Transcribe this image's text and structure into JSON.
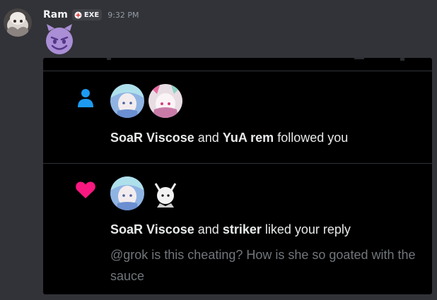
{
  "message": {
    "username": "Ram",
    "tag": "EXE",
    "timestamp": "9:32 PM",
    "emoji": "smiling-imp-emoji"
  },
  "notifications": [
    {
      "icon": "person-icon",
      "user1": "SoaR Viscose",
      "connector": "and",
      "user2": "YuA rem",
      "action": "followed you"
    },
    {
      "icon": "heart-icon",
      "user1": "SoaR Viscose",
      "connector": "and",
      "user2": "striker",
      "action": "liked your reply",
      "reply": "@grok is this cheating? How is she so goated with the sauce"
    }
  ],
  "colors": {
    "background": "#313338",
    "embed_bg": "#000000",
    "follow_icon": "#1d9bf0",
    "like_icon": "#f91880",
    "emoji_purple": "#aa8ed6"
  }
}
